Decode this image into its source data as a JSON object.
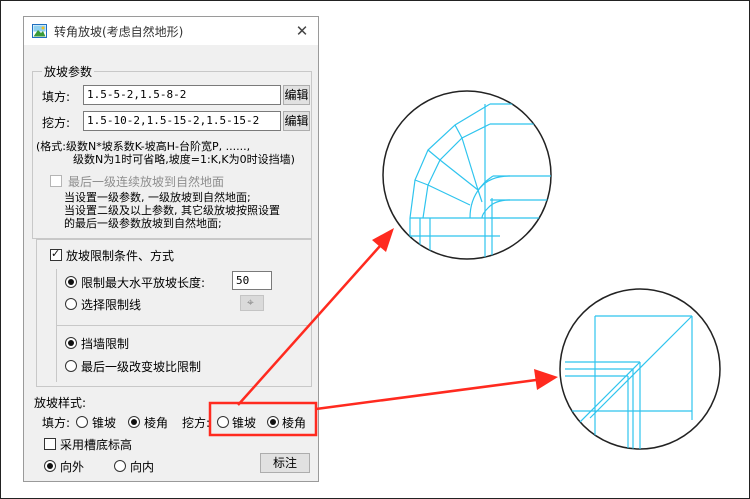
{
  "window": {
    "title": "转角放坡(考虑自然地形)"
  },
  "slope_params": {
    "label": "放坡参数",
    "fill_label": "填方:",
    "fill_value": "1.5-5-2,1.5-8-2",
    "cut_label": "挖方:",
    "cut_value": "1.5-10-2,1.5-15-2,1.5-15-2",
    "edit_label": "编辑",
    "format_line1": "(格式:级数N*坡系数K-坡高H-台阶宽P, ......,",
    "format_line2": "级数N为1时可省略,坡度=1:K,K为0时设挡墙)",
    "last_level_label": "最后一级连续放坡到自然地面",
    "note_line1": "当设置一级参数, 一级放坡到自然地面;",
    "note_line2": "当设置二级及以上参数, 其它级放坡按照设置",
    "note_line3": "的最后一级参数放坡到自然地面;"
  },
  "limit": {
    "checkbox_label": "放坡限制条件、方式",
    "max_length_label": "限制最大水平放坡长度:",
    "max_length_value": "50",
    "select_line_label": "选择限制线",
    "retaining_wall_label": "挡墙限制",
    "last_level_ratio_label": "最后一级改变坡比限制"
  },
  "style": {
    "label": "放坡样式:",
    "fill_label": "填方:",
    "cut_label": "挖方:",
    "cone_label": "锥坡",
    "prism_label": "棱角",
    "trench_label": "采用槽底标高",
    "outward_label": "向外",
    "inward_label": "向内",
    "mark_button": "标注"
  },
  "colors": {
    "accent_red": "#ff2a1f",
    "diagram_line": "#2fc4ee"
  }
}
